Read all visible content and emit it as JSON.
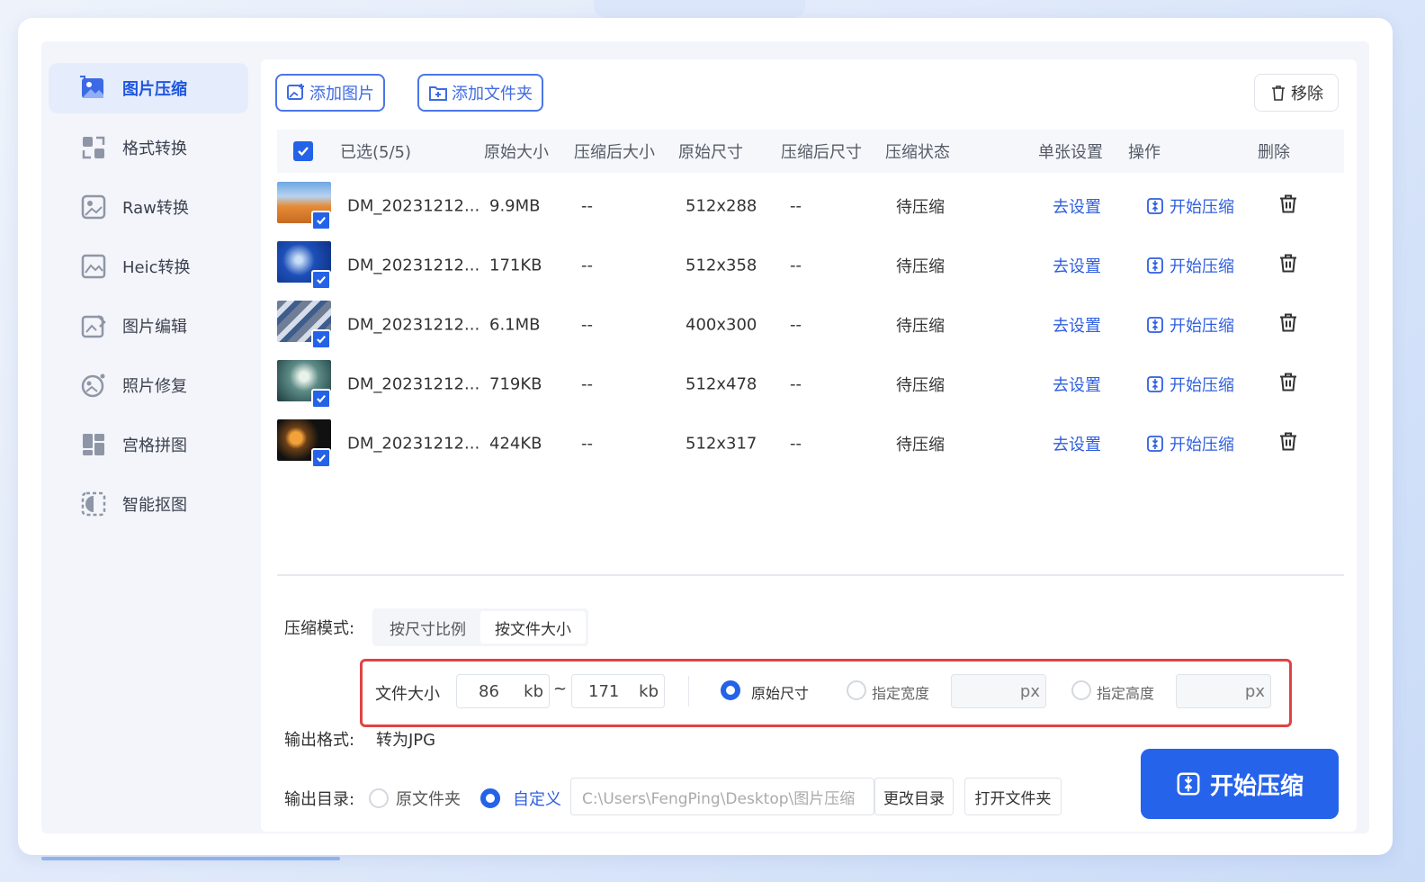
{
  "sidebar": {
    "items": [
      {
        "label": "图片压缩",
        "icon": "image-compress-icon",
        "active": true
      },
      {
        "label": "格式转换",
        "icon": "format-convert-icon"
      },
      {
        "label": "Raw转换",
        "icon": "raw-icon"
      },
      {
        "label": "Heic转换",
        "icon": "heic-icon"
      },
      {
        "label": "图片编辑",
        "icon": "image-edit-icon"
      },
      {
        "label": "照片修复",
        "icon": "photo-repair-icon"
      },
      {
        "label": "宫格拼图",
        "icon": "grid-collage-icon"
      },
      {
        "label": "智能抠图",
        "icon": "smart-cutout-icon"
      }
    ]
  },
  "toolbar": {
    "add_image": "添加图片",
    "add_folder": "添加文件夹",
    "remove": "移除"
  },
  "table": {
    "headers": {
      "selected": "已选(5/5)",
      "orig_size": "原始大小",
      "comp_size": "压缩后大小",
      "orig_dim": "原始尺寸",
      "comp_dim": "压缩后尺寸",
      "status": "压缩状态",
      "settings": "单张设置",
      "action": "操作",
      "delete": "删除"
    },
    "rows": [
      {
        "name": "DM_20231212...",
        "size": "9.9MB",
        "comp_size": "--",
        "dim": "512x288",
        "comp_dim": "--",
        "status": "待压缩",
        "settings": "去设置",
        "action": "开始压缩"
      },
      {
        "name": "DM_20231212...",
        "size": "171KB",
        "comp_size": "--",
        "dim": "512x358",
        "comp_dim": "--",
        "status": "待压缩",
        "settings": "去设置",
        "action": "开始压缩"
      },
      {
        "name": "DM_20231212...",
        "size": "6.1MB",
        "comp_size": "--",
        "dim": "400x300",
        "comp_dim": "--",
        "status": "待压缩",
        "settings": "去设置",
        "action": "开始压缩"
      },
      {
        "name": "DM_20231212...",
        "size": "719KB",
        "comp_size": "--",
        "dim": "512x478",
        "comp_dim": "--",
        "status": "待压缩",
        "settings": "去设置",
        "action": "开始压缩"
      },
      {
        "name": "DM_20231212...",
        "size": "424KB",
        "comp_size": "--",
        "dim": "512x317",
        "comp_dim": "--",
        "status": "待压缩",
        "settings": "去设置",
        "action": "开始压缩"
      }
    ]
  },
  "compress": {
    "mode_label": "压缩模式:",
    "mode_by_ratio": "按尺寸比例",
    "mode_by_size": "按文件大小",
    "file_size_label": "文件大小",
    "min_value": "86",
    "max_value": "171",
    "unit_kb": "kb",
    "tilde": "~",
    "opt_original": "原始尺寸",
    "opt_width": "指定宽度",
    "opt_height": "指定高度",
    "unit_px": "px"
  },
  "output": {
    "format_label": "输出格式:",
    "format_value": "转为JPG",
    "dir_label": "输出目录:",
    "dir_original": "原文件夹",
    "dir_custom": "自定义",
    "dir_path": "C:\\Users\\FengPing\\Desktop\\图片压缩",
    "change_dir": "更改目录",
    "open_folder": "打开文件夹"
  },
  "start_button": "开始压缩",
  "colors": {
    "accent": "#2563eb",
    "highlight_border": "#e04343"
  }
}
